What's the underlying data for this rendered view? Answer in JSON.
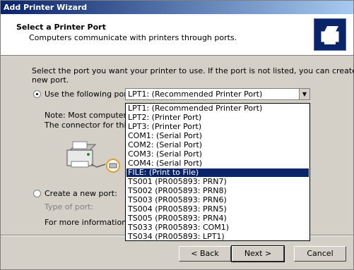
{
  "window": {
    "title": "Add Printer Wizard"
  },
  "header": {
    "title": "Select a Printer Port",
    "subtitle": "Computers communicate with printers through ports."
  },
  "body": {
    "instruction_line1": "Select the port you want your printer to use.  If the port is not listed, you can create a",
    "instruction_line2": "new port.",
    "use_port_label": "Use the following port:",
    "combo_value": "LPT1: (Recommended Printer Port)",
    "note_line1": "Note: Most computers u",
    "note_line2": "The connector for this p",
    "create_port_label": "Create a new port:",
    "type_of_port_label": "Type of port:",
    "more_info_text": "For more information abo"
  },
  "dropdown": {
    "items": [
      "LPT1: (Recommended Printer Port)",
      "LPT2: (Printer Port)",
      "LPT3: (Printer Port)",
      "COM1: (Serial Port)",
      "COM2: (Serial Port)",
      "COM3: (Serial Port)",
      "COM4: (Serial Port)",
      "FILE: (Print to File)",
      "TS001 (PR005893:  PRN7)",
      "TS002 (PR005893:  PRN8)",
      "TS003 (PR005893:  PRN6)",
      "TS004 (PR005893:  PRN5)",
      "TS005 (PR005893:  PRN4)",
      "TS033 (PR005893:  COM1)",
      "TS034 (PR005893:  LPT1)"
    ],
    "highlighted": "FILE: (Print to File)"
  },
  "buttons": {
    "back": "< Back",
    "next": "Next >",
    "cancel": "Cancel"
  }
}
